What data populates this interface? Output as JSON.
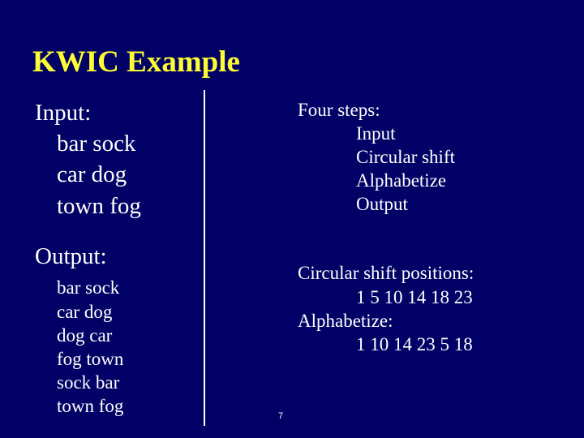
{
  "slide": {
    "title": "KWIC Example",
    "page_number": "7",
    "colors": {
      "background": "#000066",
      "title": "#ffff33",
      "text": "#ffffff"
    }
  },
  "input": {
    "heading": "Input:",
    "lines": [
      "bar sock",
      "car dog",
      "town fog"
    ]
  },
  "output": {
    "heading": "Output:",
    "lines": [
      "bar sock",
      "car dog",
      "dog car",
      "fog town",
      "sock bar",
      "town fog"
    ]
  },
  "steps": {
    "heading": "Four steps:",
    "items": [
      "Input",
      "Circular shift",
      "Alphabetize",
      "Output"
    ]
  },
  "positions": {
    "shift_heading": "Circular shift positions:",
    "shift_values": "1 5 10 14 18 23",
    "alpha_heading": "Alphabetize:",
    "alpha_values": "1 10 14 23 5 18"
  }
}
